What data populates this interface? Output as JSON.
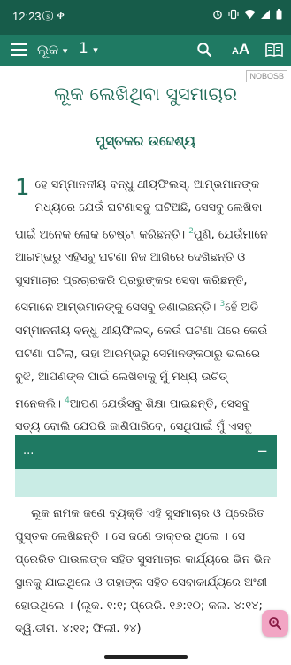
{
  "status_bar": {
    "time": "12:23",
    "left_icons": "ⓢ ቀ",
    "right_icons": [
      "alarm-icon",
      "vibrate-icon",
      "wifi-icon",
      "signal-icon",
      "battery-icon"
    ]
  },
  "toolbar": {
    "book_label": "ଲୂକ",
    "book_caret": "▾",
    "chapter_label": "1",
    "chapter_caret": "▾",
    "text_size_label": "A",
    "text_size_small": "A"
  },
  "version_tag": "NOBOSB",
  "content": {
    "book_title": "ଲୂକ ଲେଖିଥିବା ସୁସମାଚାର",
    "section_heading": "ପୁସ୍ତକର ଉଦ୍ଦେଶ୍ୟ",
    "chapter_number": "1",
    "verses": [
      {
        "num": "",
        "text": "ହେ ସମ୍ମାନନୀୟ ବନ୍ଧୁ ଥୀୟଫିଲସ୍, ଆମ୍ଭମାନଙ୍କ ମଧ୍ୟରେ ଯେଉଁ ଘଟଣାସବୁ ଘଟିଅଛି, ସେସବୁ ଲେଖିବା ପାଇଁ ଅନେକ ଲୋକ ଚେଷ୍ଟା କରିଛନ୍ତି।"
      },
      {
        "num": "2",
        "text": "ପୁଣି, ଯେଉଁମାନେ ଆରମ୍ଭରୁ ଏହିସବୁ ଘଟଣା ନିଜ ଆଖିରେ ଦେଖିଛନ୍ତି ଓ ସୁସମାଚାର ପ୍ରଚାରକରି ପ୍ରଭୁଙ୍କର ସେବା କରିଛନ୍ତି, ସେମାନେ ଆମ୍ଭମାନଙ୍କୁ ସେସବୁ ଜଣାଇଛନ୍ତି।"
      },
      {
        "num": "3",
        "text": "ହେଁ ଅତି ସମ୍ମାନନୀୟ ବନ୍ଧୁ ଥୀୟଫିଲସ୍, କେଉଁ ଘଟଣା ପରେ କେଉଁ ଘଟଣା ଘଟିଲା, ତାହା ଆରମ୍ଭରୁ ସେମାନଙ୍କଠାରୁ ଭଲରେ ବୁଝି, ଆପଣଙ୍କ ପାଇଁ ଲେଖିବାକୁ ମୁଁ ମଧ୍ୟ ଉଚିତ୍ ମନେକଲି।"
      },
      {
        "num": "4",
        "text": "ଆପଣ ଯେଉଁସବୁ ଶିକ୍ଷା ପାଇଛନ୍ତି, ସେସବୁ ସତ୍ୟ ବୋଲି ଯେପରି ଜାଣିପାରିବେ, ସେଥିପାଇଁ ମୁଁ ଏସବୁ ଲେଖୁଅଛି।"
      }
    ],
    "note_bar_text": "...",
    "note_bar_collapse": "−",
    "intro_text": "ଲୂକ ନାମକ ଜଣେ ବ୍ୟକ୍ତି ଏହି ସୁସମାଚାର ଓ ପ୍ରେରିତ ପୁସ୍ତକ ଲେଖିଛନ୍ତି । ସେ ଜଣେ ଡାକ୍ତର ଥିଲେ । ସେ ପ୍ରେରିତ ପାଉଲଙ୍କ ସହିତ ସୁସମାଚାର କାର୍ଯ୍ୟରେ ଭିନ ଭିନ ସ୍ଥାନକୁ ଯାଇଥିଲେ ଓ ତାହାଙ୍କ ସହିତ ସେବାକାର୍ଯ୍ୟରେ ଅଂଶୀ ହୋଇଥିଲେ । (ଲୂକ. ୧:୧; ପ୍ରେରି. ୧୬:୧୦; କଲ. ୪:୧୪; ଦ୍ୱି.ତୀମ. ୪:୧୧; ଫିଲୀ. ୨୪)"
  },
  "colors": {
    "status_bar": "#175c4a",
    "toolbar": "#1f7a63",
    "heading": "#1f6b57",
    "verse_number": "#4caf8f",
    "note_body": "#c9ece5",
    "fab": "#f2a5c4"
  }
}
